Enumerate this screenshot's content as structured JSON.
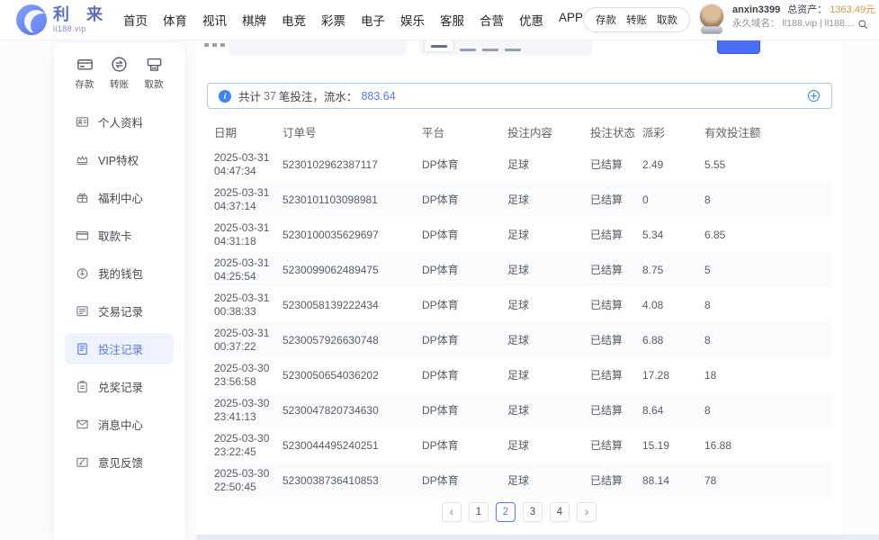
{
  "nav": {
    "logo": {
      "title": "利 来",
      "domain": "ll188.vip"
    },
    "items": [
      "首页",
      "体育",
      "视讯",
      "棋牌",
      "电竞",
      "彩票",
      "电子",
      "娱乐",
      "客服",
      "合营",
      "优惠",
      "APP"
    ],
    "wallet_actions": [
      "存款",
      "转账",
      "取款"
    ],
    "user": {
      "name": "anxin3399",
      "assets_label": "总资产：",
      "assets_value": "1363.49元",
      "domain_label": "永久域名：",
      "domain_value": "ll188.vip | ll188....",
      "search_icon": "search-icon"
    }
  },
  "sidebar": {
    "quick_actions": [
      {
        "label": "存款",
        "icon": "deposit-icon"
      },
      {
        "label": "转账",
        "icon": "transfer-icon"
      },
      {
        "label": "取款",
        "icon": "withdraw-icon"
      }
    ],
    "items": [
      {
        "label": "个人资料",
        "icon": "profile-icon",
        "active": false
      },
      {
        "label": "VIP特权",
        "icon": "vip-icon",
        "active": false
      },
      {
        "label": "福利中心",
        "icon": "welfare-icon",
        "active": false
      },
      {
        "label": "取款卡",
        "icon": "card-icon",
        "active": false
      },
      {
        "label": "我的钱包",
        "icon": "wallet-icon",
        "active": false
      },
      {
        "label": "交易记录",
        "icon": "transactions-icon",
        "active": false
      },
      {
        "label": "投注记录",
        "icon": "bets-icon",
        "active": true
      },
      {
        "label": "兑奖记录",
        "icon": "redeem-icon",
        "active": false
      },
      {
        "label": "消息中心",
        "icon": "messages-icon",
        "active": false
      },
      {
        "label": "意见反馈",
        "icon": "feedback-icon",
        "active": false
      }
    ]
  },
  "summary": {
    "prefix": "共计",
    "count": "37",
    "middle": "笔投注，流水：",
    "flow": "883.64"
  },
  "table": {
    "columns": [
      "日期",
      "订单号",
      "平台",
      "投注内容",
      "投注状态",
      "派彩",
      "有效投注额"
    ],
    "rows": [
      {
        "date": "2025-03-31",
        "time": "04:47:34",
        "order": "5230102962387117",
        "platform": "DP体育",
        "content": "足球",
        "status": "已结算",
        "payout": "2.49",
        "valid": "5.55"
      },
      {
        "date": "2025-03-31",
        "time": "04:37:14",
        "order": "5230101103098981",
        "platform": "DP体育",
        "content": "足球",
        "status": "已结算",
        "payout": "0",
        "valid": "8"
      },
      {
        "date": "2025-03-31",
        "time": "04:31:18",
        "order": "5230100035629697",
        "platform": "DP体育",
        "content": "足球",
        "status": "已结算",
        "payout": "5.34",
        "valid": "6.85"
      },
      {
        "date": "2025-03-31",
        "time": "04:25:54",
        "order": "5230099062489475",
        "platform": "DP体育",
        "content": "足球",
        "status": "已结算",
        "payout": "8.75",
        "valid": "5"
      },
      {
        "date": "2025-03-31",
        "time": "00:38:33",
        "order": "5230058139222434",
        "platform": "DP体育",
        "content": "足球",
        "status": "已结算",
        "payout": "4.08",
        "valid": "8"
      },
      {
        "date": "2025-03-31",
        "time": "00:37:22",
        "order": "5230057926630748",
        "platform": "DP体育",
        "content": "足球",
        "status": "已结算",
        "payout": "6.88",
        "valid": "8"
      },
      {
        "date": "2025-03-30",
        "time": "23:56:58",
        "order": "5230050654036202",
        "platform": "DP体育",
        "content": "足球",
        "status": "已结算",
        "payout": "17.28",
        "valid": "18"
      },
      {
        "date": "2025-03-30",
        "time": "23:41:13",
        "order": "5230047820734630",
        "platform": "DP体育",
        "content": "足球",
        "status": "已结算",
        "payout": "8.64",
        "valid": "8"
      },
      {
        "date": "2025-03-30",
        "time": "23:22:45",
        "order": "5230044495240251",
        "platform": "DP体育",
        "content": "足球",
        "status": "已结算",
        "payout": "15.19",
        "valid": "16.88"
      },
      {
        "date": "2025-03-30",
        "time": "22:50:45",
        "order": "5230038736410853",
        "platform": "DP体育",
        "content": "足球",
        "status": "已结算",
        "payout": "88.14",
        "valid": "78"
      }
    ]
  },
  "pagination": {
    "prev_label": "‹",
    "next_label": "›",
    "pages": [
      "1",
      "2",
      "3",
      "4"
    ],
    "active": "2"
  },
  "colors": {
    "primary_blue": "#5677f5",
    "button_blue": "#4c6ef5",
    "info_blue": "#3d84f7",
    "asset_orange": "#e0963f",
    "active_item_bg": "#eef3fe"
  }
}
